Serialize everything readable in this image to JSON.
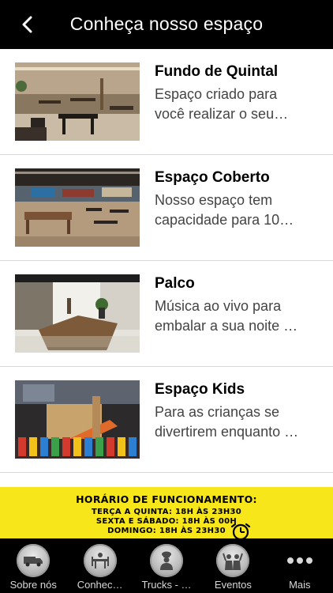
{
  "header": {
    "title": "Conheça nosso espaço",
    "back_icon": "chevron-left-icon"
  },
  "items": [
    {
      "title": "Fundo de Quintal",
      "desc1": "Espaço criado para",
      "desc2": "você realizar o seu…"
    },
    {
      "title": "Espaço Coberto",
      "desc1": "Nosso espaço tem",
      "desc2": "capacidade para 10…"
    },
    {
      "title": "Palco",
      "desc1": "Música ao vivo para",
      "desc2": "embalar a sua noite …"
    },
    {
      "title": "Espaço Kids",
      "desc1": "Para as crianças se",
      "desc2": "divertirem enquanto …"
    }
  ],
  "banner": {
    "title": "HORÁRIO DE FUNCIONAMENTO:",
    "line1": "TERÇA A QUINTA: 18H ÀS 23H30",
    "line2": "SEXTA E SÁBADO: 18H ÀS 00H",
    "line3": "DOMINGO: 18H ÀS 23H30",
    "background": "#f7e619"
  },
  "tabs": [
    {
      "label": "Sobre nós",
      "icon": "truck-icon"
    },
    {
      "label": "Conhec…",
      "icon": "dining-table-icon"
    },
    {
      "label": "Trucks - …",
      "icon": "chef-icon"
    },
    {
      "label": "Eventos",
      "icon": "people-celebrating-icon"
    },
    {
      "label": "Mais",
      "icon": "more-dots-icon"
    }
  ],
  "colors": {
    "header_bg": "#000000",
    "tabbar_bg": "#000000",
    "accent_yellow": "#f7e619"
  }
}
